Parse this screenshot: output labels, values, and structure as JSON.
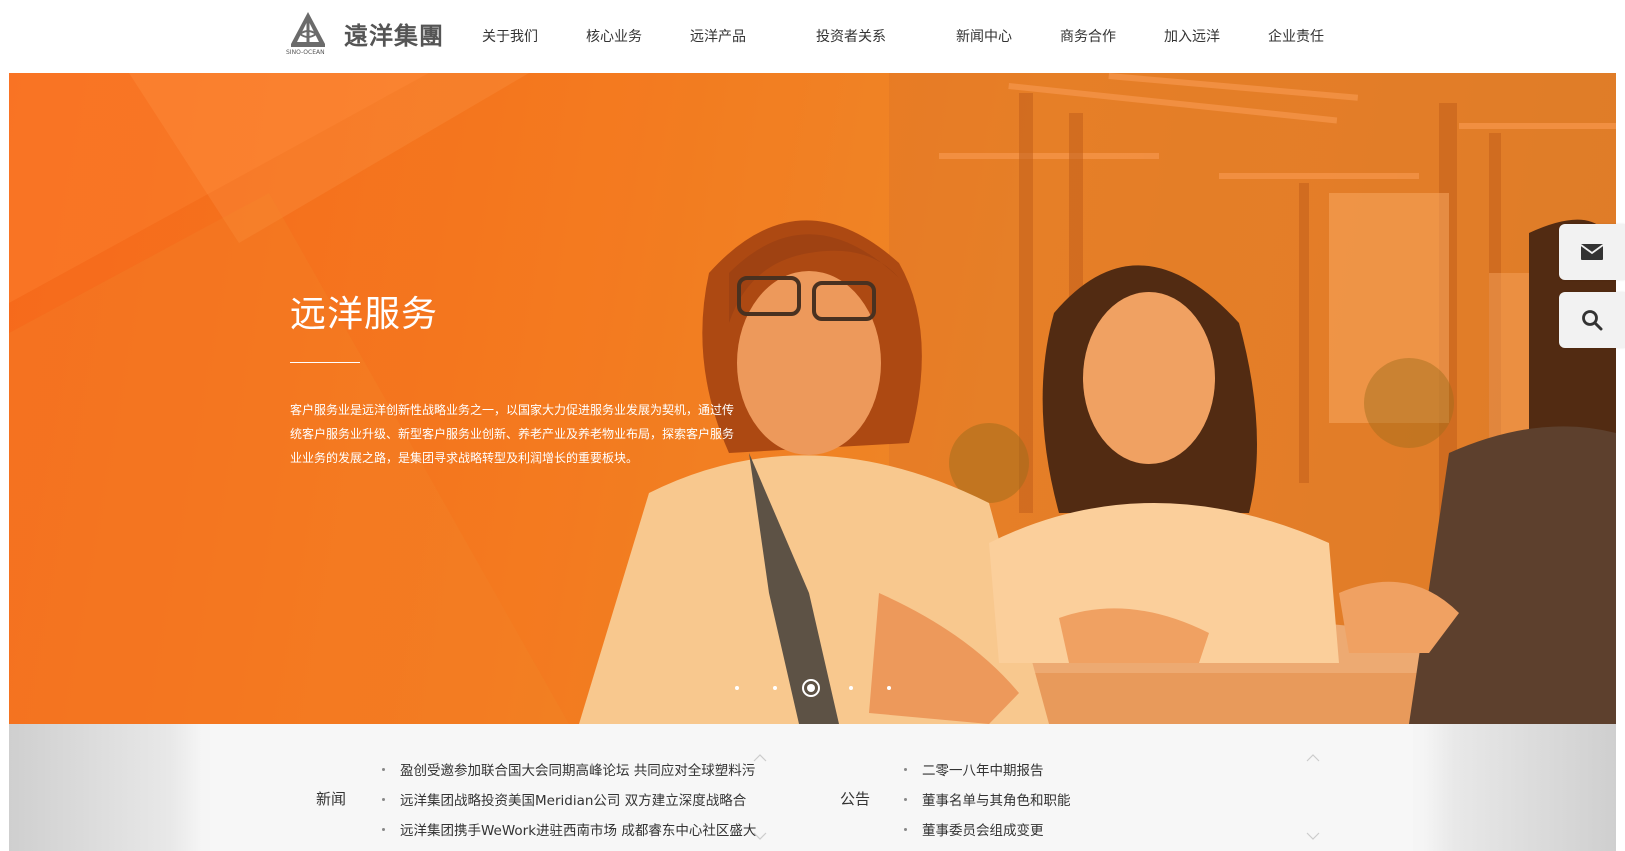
{
  "brand": {
    "name_cn": "遠洋集團",
    "name_en": "SINO-OCEAN"
  },
  "nav": [
    {
      "label": "关于我们"
    },
    {
      "label": "核心业务"
    },
    {
      "label": "远洋产品"
    },
    {
      "label": "投资者关系"
    },
    {
      "label": "新闻中心"
    },
    {
      "label": "商务合作"
    },
    {
      "label": "加入远洋"
    },
    {
      "label": "企业责任"
    }
  ],
  "hero": {
    "title": "远洋服务",
    "description": "客户服务业是远洋创新性战略业务之一，以国家大力促进服务业发展为契机，通过传统客户服务业升级、新型客户服务业创新、养老产业及养老物业布局，探索客户服务业业务的发展之路，是集团寻求战略转型及利润增长的重要板块。",
    "slides": 5,
    "active_slide": 3,
    "overlay_color": "#f4661c"
  },
  "side_buttons": [
    {
      "icon": "mail-icon"
    },
    {
      "icon": "search-icon"
    }
  ],
  "news": {
    "label": "新闻",
    "items": [
      "盈创受邀参加联合国大会同期高峰论坛 共同应对全球塑料污",
      "远洋集团战略投资美国Meridian公司 双方建立深度战略合",
      "远洋集团携手WeWork进驻西南市场 成都睿东中心社区盛大"
    ]
  },
  "notice": {
    "label": "公告",
    "items": [
      "二零一八年中期报告",
      "董事名单与其角色和职能",
      "董事委员会组成变更"
    ]
  }
}
